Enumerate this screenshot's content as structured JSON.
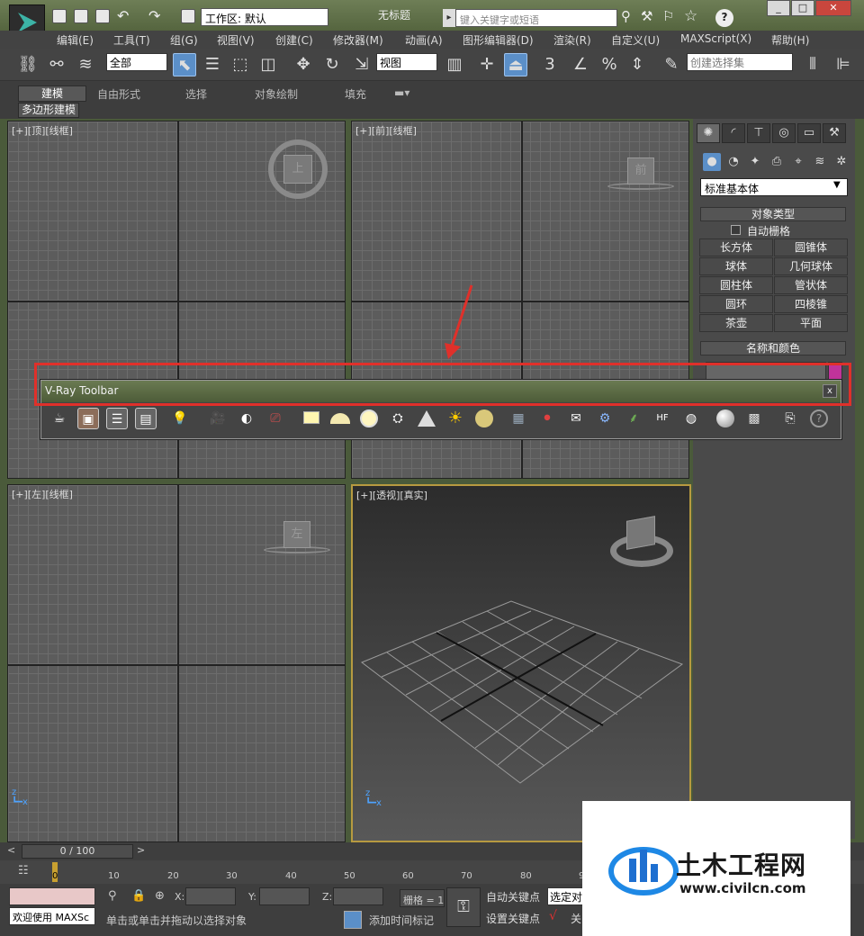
{
  "title_bar": {
    "workspace_label": "工作区: 默认",
    "window_title": "无标题",
    "search_placeholder": "键入关键字或短语",
    "help_label": "?"
  },
  "menus": [
    "编辑(E)",
    "工具(T)",
    "组(G)",
    "视图(V)",
    "创建(C)",
    "修改器(M)",
    "动画(A)",
    "图形编辑器(D)",
    "渲染(R)",
    "自定义(U)",
    "MAXScript(X)",
    "帮助(H)"
  ],
  "toolbar": {
    "selection_filter": "全部",
    "reference_coord": "视图",
    "snap_3": "3",
    "selection_set_placeholder": "创建选择集"
  },
  "ribbon": {
    "tabs": [
      "建模",
      "自由形式",
      "选择",
      "对象绘制",
      "填充"
    ],
    "subtab": "多边形建模"
  },
  "viewports": [
    {
      "label": "[+][顶][线框]",
      "cube_text": "上"
    },
    {
      "label": "[+][前][线框]",
      "cube_text": "前"
    },
    {
      "label": "[+][左][线框]",
      "cube_text": "左"
    },
    {
      "label": "[+][透视][真实]",
      "cube_text": ""
    }
  ],
  "command_panel": {
    "dropdown": "标准基本体",
    "object_type_header": "对象类型",
    "autogrid_label": "自动栅格",
    "objects": [
      "长方体",
      "圆锥体",
      "球体",
      "几何球体",
      "圆柱体",
      "管状体",
      "圆环",
      "四棱锥",
      "茶壶",
      "平面"
    ],
    "name_color_header": "名称和颜色",
    "accent_color": "#c0339a"
  },
  "vray_toolbar": {
    "title": "V-Ray Toolbar",
    "close": "x",
    "icons": [
      "teapot-icon",
      "frame-buffer-icon",
      "render-settings-icon",
      "properties-icon",
      "light-lister-icon",
      "camera-icon",
      "dome-camera-icon",
      "physical-camera-icon",
      "vray-light-icon",
      "dome-light-icon",
      "sphere-light-icon",
      "ies-light-icon",
      "cone-light-icon",
      "sun-icon",
      "ambient-light-icon",
      "proxy-icon",
      "material-icon",
      "mesh-export-icon",
      "settings-gear-icon",
      "fur-icon",
      "hair-icon",
      "infinite-plane-icon",
      "sphere-icon",
      "vfb-history-icon",
      "export-icon",
      "help-icon"
    ]
  },
  "timeline": {
    "counter": "0 / 100",
    "ticks": [
      "0",
      "10",
      "20",
      "30",
      "40",
      "50",
      "60",
      "70",
      "80",
      "90"
    ]
  },
  "status": {
    "welcome": "欢迎使用 MAXSc",
    "prompt": "单击或单击并拖动以选择对象",
    "x_label": "X:",
    "y_label": "Y:",
    "z_label": "Z:",
    "grid_label": "栅格 = 1",
    "add_time_tag": "添加时间标记",
    "auto_key": "自动关键点",
    "set_key": "设置关键点",
    "selected": "选定对",
    "close_char": "关"
  },
  "watermark": {
    "title": "土木工程网",
    "url": "www.civilcn.com"
  }
}
